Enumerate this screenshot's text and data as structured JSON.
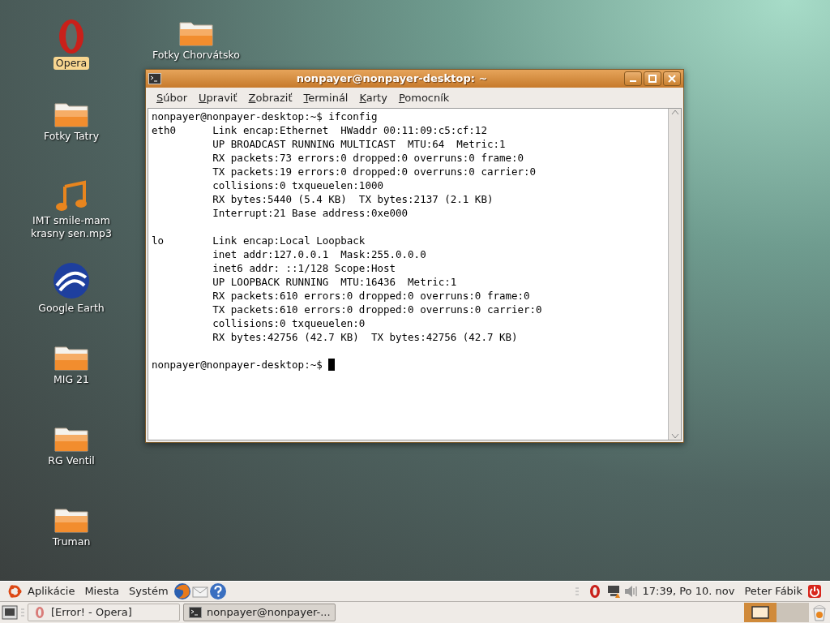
{
  "desktop_icons": [
    [
      {
        "kind": "opera",
        "label": "Opera",
        "selected": true
      },
      {
        "kind": "folder",
        "label": "Fotky Tatry",
        "selected": false
      },
      {
        "kind": "music",
        "label": "IMT smile-mam krasny sen.mp3",
        "selected": false
      },
      {
        "kind": "globe",
        "label": "Google Earth",
        "selected": false
      },
      {
        "kind": "folder",
        "label": "MIG 21",
        "selected": false
      },
      {
        "kind": "folder",
        "label": "RG Ventil",
        "selected": false
      },
      {
        "kind": "folder",
        "label": "Truman",
        "selected": false
      }
    ],
    [
      {
        "kind": "folder",
        "label": "Fotky Chorvátsko",
        "selected": false
      }
    ]
  ],
  "window": {
    "title": "nonpayer@nonpayer-desktop: ~",
    "menu": [
      "Súbor",
      "Upraviť",
      "Zobraziť",
      "Terminál",
      "Karty",
      "Pomocník"
    ],
    "blocks": [
      [
        "nonpayer@nonpayer-desktop:~$ ifconfig",
        "eth0      Link encap:Ethernet  HWaddr 00:11:09:c5:cf:12",
        "          UP BROADCAST RUNNING MULTICAST  MTU:64  Metric:1",
        "          RX packets:73 errors:0 dropped:0 overruns:0 frame:0",
        "          TX packets:19 errors:0 dropped:0 overruns:0 carrier:0",
        "          collisions:0 txqueuelen:1000",
        "          RX bytes:5440 (5.4 KB)  TX bytes:2137 (2.1 KB)",
        "          Interrupt:21 Base address:0xe000"
      ],
      [
        "lo        Link encap:Local Loopback",
        "          inet addr:127.0.0.1  Mask:255.0.0.0",
        "          inet6 addr: ::1/128 Scope:Host",
        "          UP LOOPBACK RUNNING  MTU:16436  Metric:1",
        "          RX packets:610 errors:0 dropped:0 overruns:0 frame:0",
        "          TX packets:610 errors:0 dropped:0 overruns:0 carrier:0",
        "          collisions:0 txqueuelen:0",
        "          RX bytes:42756 (42.7 KB)  TX bytes:42756 (42.7 KB)"
      ],
      [
        "nonpayer@nonpayer-desktop:~$ "
      ]
    ]
  },
  "top_panel": {
    "menus": [
      "Aplikácie",
      "Miesta",
      "Systém"
    ],
    "clock": "17:39, Po 10. nov",
    "user": "Peter Fábik"
  },
  "bottom_panel": {
    "tasks": [
      {
        "label": "[Error! - Opera]",
        "kind": "opera",
        "selected": false
      },
      {
        "label": "nonpayer@nonpayer-...",
        "kind": "terminal",
        "selected": true
      }
    ],
    "workspaces": [
      {
        "selected": true
      },
      {
        "selected": false
      }
    ]
  }
}
